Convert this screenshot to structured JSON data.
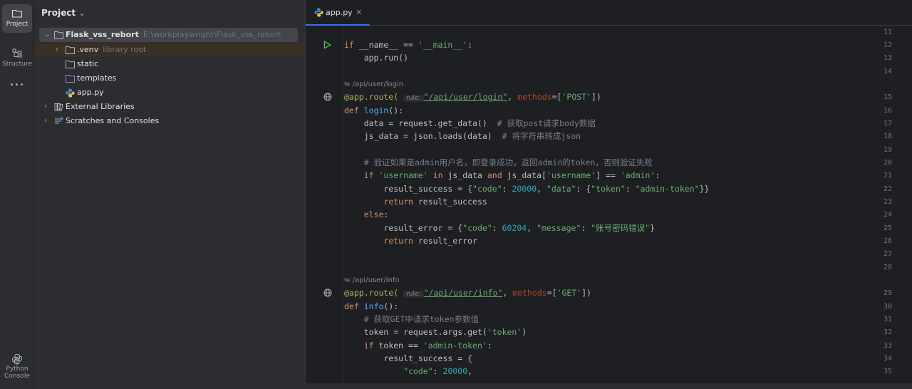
{
  "toolstrip": {
    "project_label": "Project",
    "structure_label": "Structure",
    "more_label": "•••",
    "python_console_label_1": "Python",
    "python_console_label_2": "Console"
  },
  "project_panel": {
    "title": "Project",
    "tree": [
      {
        "label": "Flask_vss_rebort",
        "hint": "E:\\workplaywright\\Flask_vss_rebort"
      },
      {
        "label": ".venv",
        "hint": "library root"
      },
      {
        "label": "static"
      },
      {
        "label": "templates"
      },
      {
        "label": "app.py"
      },
      {
        "label": "External Libraries"
      },
      {
        "label": "Scratches and Consoles"
      }
    ]
  },
  "editor": {
    "tab_label": "app.py",
    "tab_close": "×",
    "line_numbers": [
      "11",
      "12",
      "13",
      "14",
      "15",
      "16",
      "17",
      "18",
      "19",
      "20",
      "21",
      "22",
      "23",
      "24",
      "25",
      "26",
      "27",
      "28",
      "29",
      "30",
      "31",
      "32",
      "33",
      "34",
      "35"
    ],
    "inlay_login": "/api/user/login",
    "inlay_info": "/api/user/info",
    "rule_hint": "rule:",
    "comment_getdata": "# 获取post请求body数据",
    "comment_loads": "# 将字符串转成json",
    "comment_verify": "# 验证如果是admin用户名，即登录成功，返回admin的token，否则验证失败",
    "comment_token": "# 获取GET中请求token参数值",
    "error_message": "\"账号密码错误\"",
    "colors": {
      "keyword": "#cf8e6d",
      "string": "#6aab73",
      "number": "#2aacb8",
      "function": "#56a8f5",
      "decorator": "#b3ae60"
    }
  }
}
